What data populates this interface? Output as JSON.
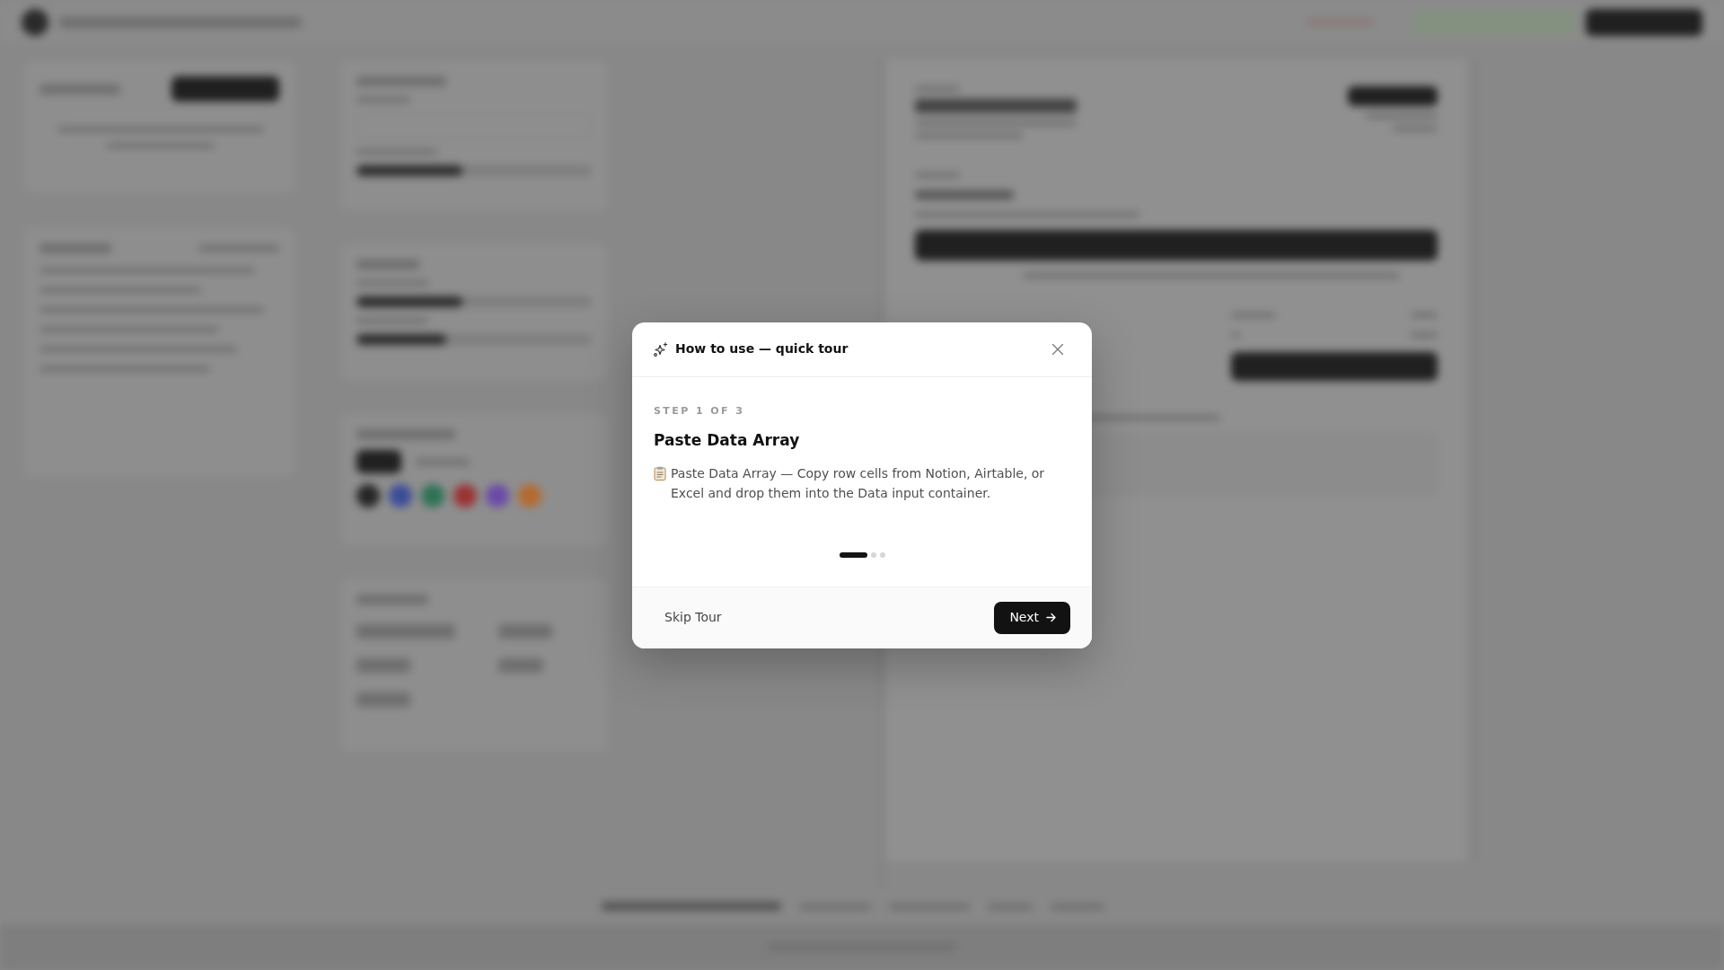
{
  "tour_dialog": {
    "title": "How to use — quick tour",
    "step_label": "STEP 1 OF 3",
    "heading": "Paste Data Array",
    "body": "Paste Data Array — Copy row cells from Notion, Airtable, or Excel and drop them into the Data input container.",
    "steps": [
      {
        "selected": true
      },
      {
        "selected": false
      },
      {
        "selected": false
      }
    ],
    "buttons": [
      {
        "kind": "secondary",
        "label": "Skip Tour"
      },
      {
        "kind": "primary",
        "label": "Next"
      }
    ]
  }
}
